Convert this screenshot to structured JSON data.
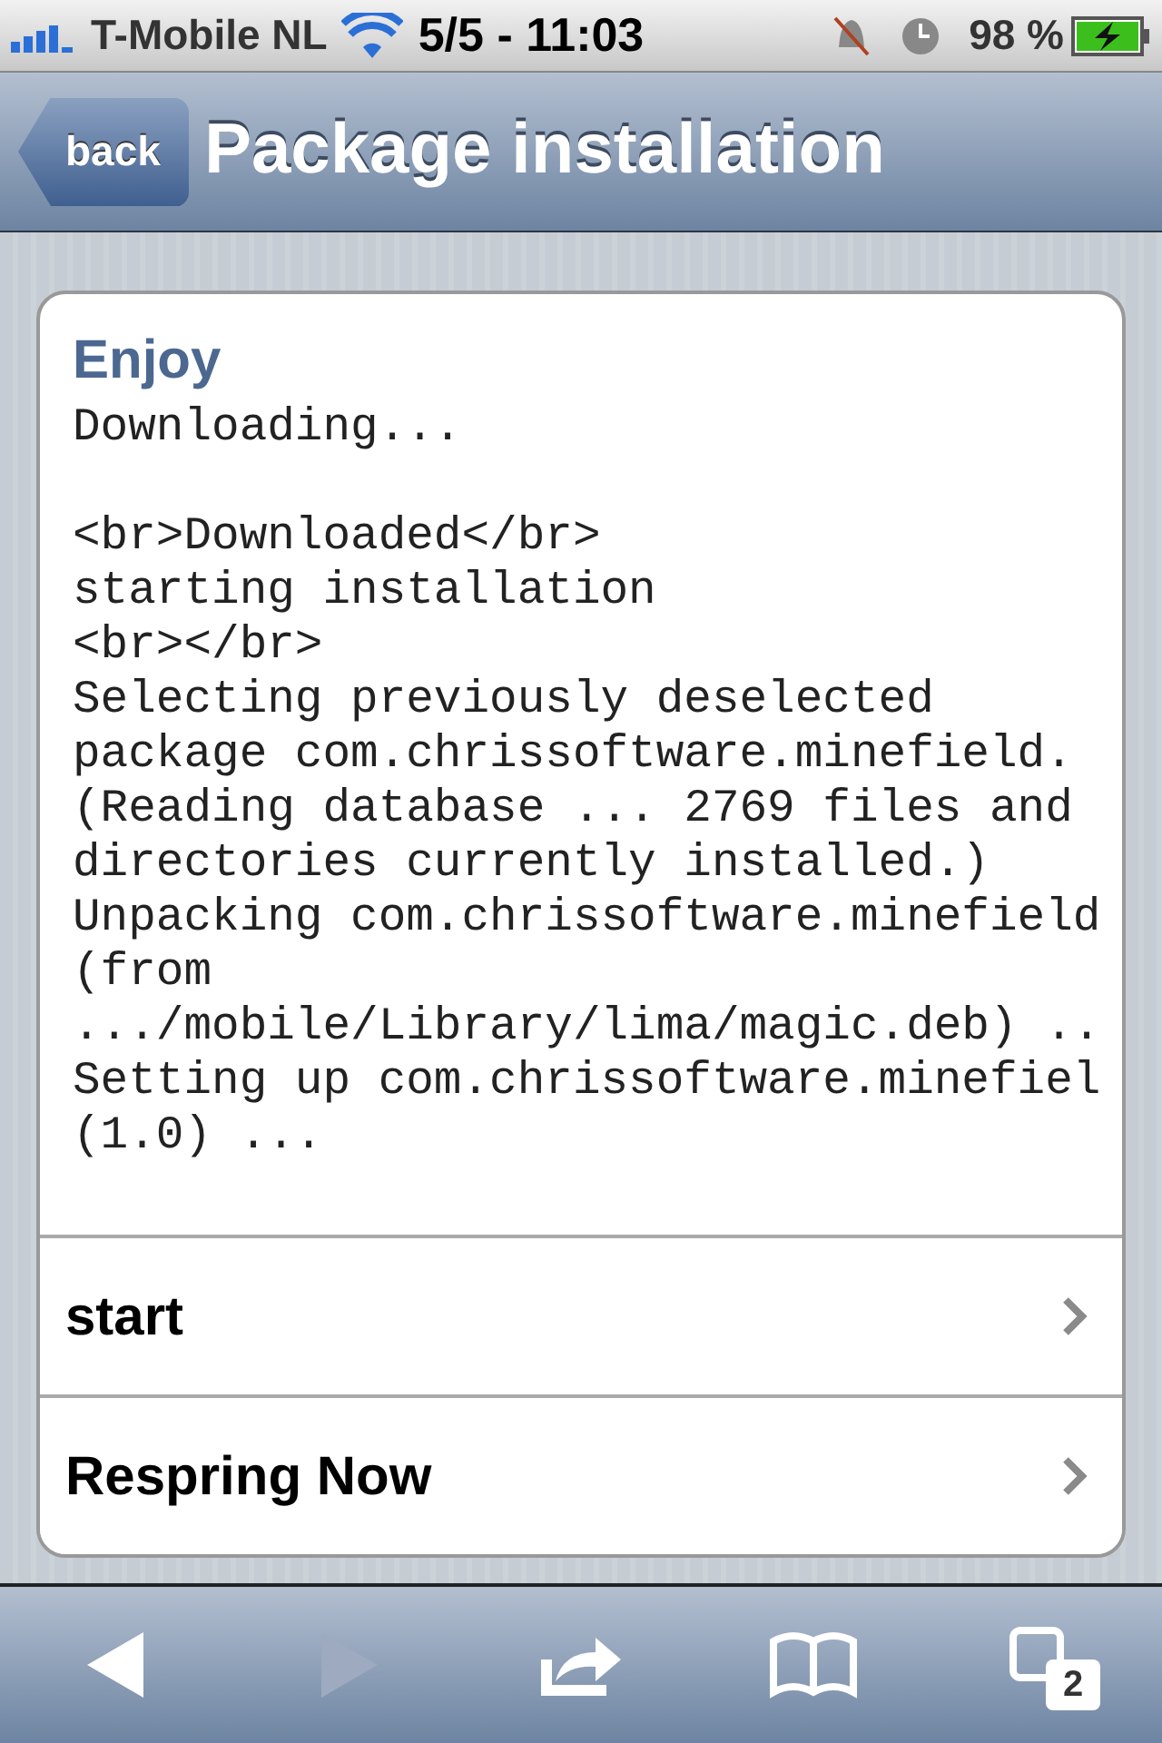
{
  "status_bar": {
    "carrier": "T-Mobile NL",
    "time": "5/5 - 11:03",
    "battery": "98 %",
    "charging": true
  },
  "nav_bar": {
    "back": "back",
    "title": "Package installation"
  },
  "card": {
    "title": "Enjoy",
    "log_paragraphs": [
      [
        "Downloading..."
      ],
      [
        "<br>Downloaded</br>",
        "starting installation",
        "<br></br>",
        "Selecting previously deselected",
        "package com.chrissoftware.minefield.",
        "(Reading database ... 2769 files and",
        "directories currently installed.)",
        "Unpacking com.chrissoftware.minefield",
        "(from",
        ".../mobile/Library/lima/magic.deb) ..",
        "Setting up com.chrissoftware.minefiel",
        "(1.0) ..."
      ]
    ],
    "items": [
      {
        "label": "start"
      },
      {
        "label": "Respring Now"
      }
    ]
  },
  "toolbar": [
    {
      "kind": "back",
      "disabled": false
    },
    {
      "kind": "forward",
      "disabled": true
    },
    {
      "kind": "share",
      "disabled": false
    },
    {
      "kind": "bookmarks",
      "disabled": false
    },
    {
      "kind": "pages",
      "disabled": false,
      "count": "2"
    }
  ]
}
